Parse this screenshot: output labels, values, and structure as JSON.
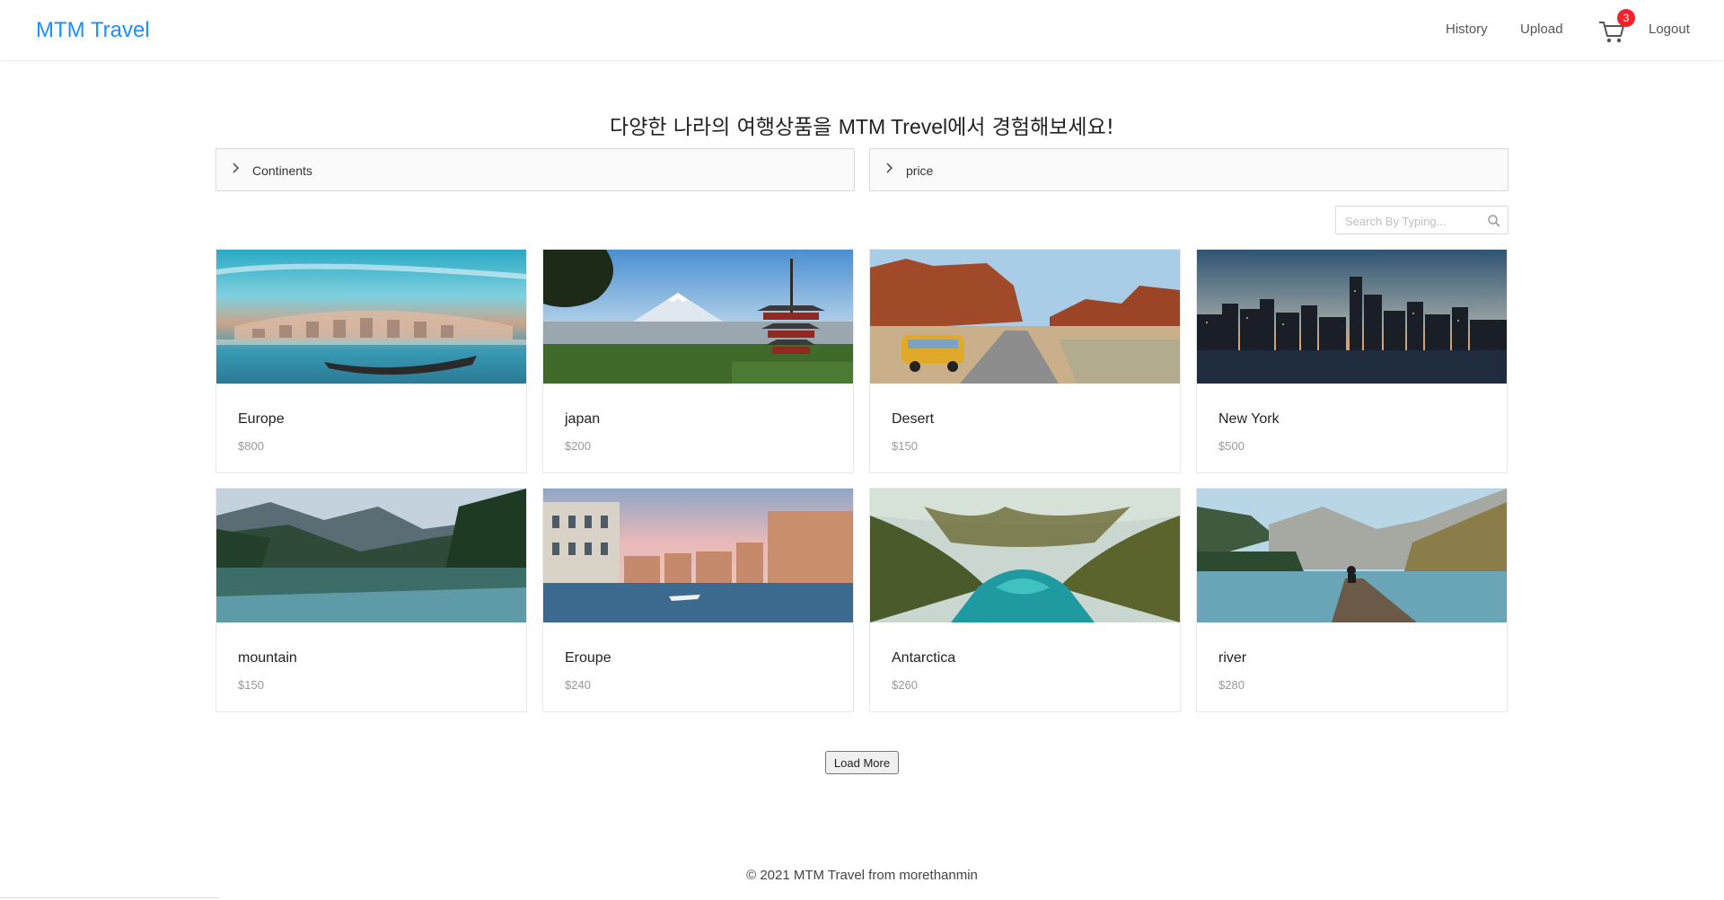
{
  "header": {
    "logo": "MTM Travel",
    "nav": {
      "history": "History",
      "upload": "Upload",
      "logout": "Logout"
    },
    "cart": {
      "icon": "cart-icon",
      "badge_count": "3"
    }
  },
  "headline": {
    "before": "다양한 나라의 여행상품을 ",
    "brand": "MTM Trevel",
    "after": "에서 경험해보세요!"
  },
  "filters": {
    "continents": {
      "label": "Continents",
      "icon": "chevron-right-icon"
    },
    "price": {
      "label": "price",
      "icon": "chevron-right-icon"
    }
  },
  "search": {
    "placeholder": "Search By Typing...",
    "value": "",
    "icon": "search-icon"
  },
  "products": [
    {
      "title": "Europe",
      "price": "$800",
      "image": "venice-gondola-photo"
    },
    {
      "title": "japan",
      "price": "$200",
      "image": "mount-fuji-pagoda-photo"
    },
    {
      "title": "Desert",
      "price": "$150",
      "image": "desert-road-van-photo"
    },
    {
      "title": "New York",
      "price": "$500",
      "image": "city-skyline-dusk-photo"
    },
    {
      "title": "mountain",
      "price": "$150",
      "image": "mountain-lake-photo"
    },
    {
      "title": "Eroupe",
      "price": "$240",
      "image": "venice-canal-photo"
    },
    {
      "title": "Antarctica",
      "price": "$260",
      "image": "lagoon-palms-photo"
    },
    {
      "title": "river",
      "price": "$280",
      "image": "lake-dock-photo"
    }
  ],
  "load_more": "Load More",
  "footer": {
    "text": "© 2021 MTM Travel from morethanmin"
  },
  "colors": {
    "brand": "#1890ff",
    "badge": "#f5222d"
  }
}
